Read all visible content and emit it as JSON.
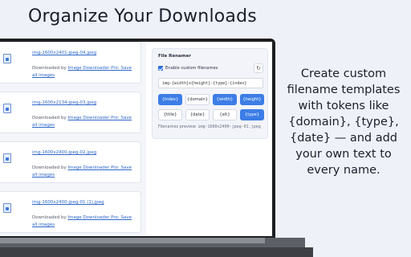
{
  "headline": "Organize Your Downloads",
  "description": "Create custom filename templates with tokens like {domain}, {type}, {date} — and add your own text to every name.",
  "files": [
    {
      "name": "img-1600x2401-jpeg-04.jpeg",
      "prefix": "Downloaded by ",
      "link": "Image Downloader Pro: Save all images"
    },
    {
      "name": "img-1600x2134-jpeg-03.jpeg",
      "prefix": "Downloaded by ",
      "link": "Image Downloader Pro: Save all images"
    },
    {
      "name": "img-1600x2400-jpeg-02.jpeg",
      "prefix": "Downloaded by ",
      "link": "Image Downloader Pro: Save all images"
    },
    {
      "name": "img-1600x2400-jpeg-01 (1).jpeg",
      "prefix": "Downloaded by ",
      "link": "Image Downloader Pro: Save all images"
    }
  ],
  "renamer": {
    "title": "File Renamer",
    "enable_label": "Enable custom filenames",
    "enabled": true,
    "reset_icon": "refresh-icon",
    "template_value": "img-{width}x{height}-{type}-{index}",
    "tokens": [
      {
        "label": "{index}",
        "active": true
      },
      {
        "label": "{domain}",
        "active": false
      },
      {
        "label": "{width}",
        "active": true
      },
      {
        "label": "{height}",
        "active": true
      },
      {
        "label": "{title}",
        "active": false
      },
      {
        "label": "{date}",
        "active": false
      },
      {
        "label": "{alt}",
        "active": false
      },
      {
        "label": "{type}",
        "active": true
      }
    ],
    "preview_label": "Filenames preview: ",
    "preview_value": "img-1600x2400-jpeg-01.jpeg"
  },
  "colors": {
    "accent": "#3c7de6",
    "link": "#2d67c8",
    "background": "#eef1f8"
  }
}
